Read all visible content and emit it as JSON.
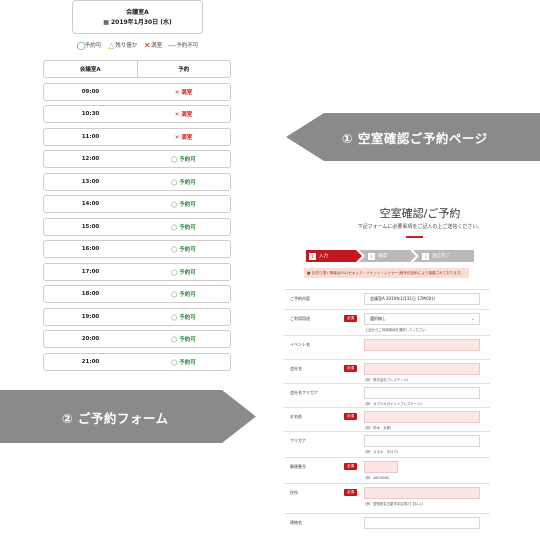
{
  "room_header": {
    "name": "会議室A",
    "date": "▦ 2019年1月30日 (水)"
  },
  "legend": [
    {
      "symbol": "◯",
      "label": "予約可",
      "color": "#2a8a3a"
    },
    {
      "symbol": "△",
      "label": "残り僅か",
      "color": "#e2a12b"
    },
    {
      "symbol": "✕",
      "label": "満室",
      "color": "#d92020"
    },
    {
      "symbol": "―",
      "label": "予約不可",
      "color": "#777777"
    }
  ],
  "grid": {
    "headers": [
      "会議室A",
      "予約"
    ],
    "rows": [
      {
        "time": "09:00",
        "status": "✕ 満室",
        "state": "full"
      },
      {
        "time": "10:30",
        "status": "✕ 満室",
        "state": "full"
      },
      {
        "time": "11:00",
        "status": "✕ 満室",
        "state": "full"
      },
      {
        "time": "12:00",
        "status": "◯ 予約可",
        "state": "ok"
      },
      {
        "time": "13:00",
        "status": "◯ 予約可",
        "state": "ok"
      },
      {
        "time": "14:00",
        "status": "◯ 予約可",
        "state": "ok"
      },
      {
        "time": "15:00",
        "status": "◯ 予約可",
        "state": "ok"
      },
      {
        "time": "16:00",
        "status": "◯ 予約可",
        "state": "ok"
      },
      {
        "time": "17:00",
        "status": "◯ 予約可",
        "state": "ok"
      },
      {
        "time": "18:00",
        "status": "◯ 予約可",
        "state": "ok"
      },
      {
        "time": "19:00",
        "status": "◯ 予約可",
        "state": "ok"
      },
      {
        "time": "20:00",
        "status": "◯ 予約可",
        "state": "ok"
      },
      {
        "time": "21:00",
        "status": "◯ 予約可",
        "state": "ok"
      }
    ]
  },
  "callouts": {
    "availability": "① 空室確認ご予約ページ",
    "form": "② ご予約フォーム"
  },
  "form": {
    "title": "空室確認/ご予約",
    "subtitle": "下記フォームに必要事項をご記入の上ご送信ください。",
    "steps": [
      {
        "num": "1",
        "label": "入力"
      },
      {
        "num": "2",
        "label": "確認"
      },
      {
        "num": "3",
        "label": "送信完了"
      }
    ],
    "notice": "■ お送り頂く情報はSSL(セキュア・ソケット・レイヤー)暗号化技術により保護されております。",
    "required_label": "必須",
    "fields": [
      {
        "label": "ご予約内容",
        "value": "会議室A  2019年1月31日  17時00分",
        "required": false,
        "pink": false
      },
      {
        "label": "ご利用用途",
        "value": "選択無し",
        "required": true,
        "pink": false,
        "hint": "上記からご利用用途を選択してください"
      },
      {
        "label": "イベント名",
        "value": "",
        "required": false,
        "pink": true
      },
      {
        "label": "会社名",
        "value": "",
        "required": true,
        "pink": true,
        "hint": "(例：株式会社ブレステージ)"
      },
      {
        "label": "会社名フリガナ",
        "value": "",
        "required": false,
        "pink": false,
        "hint": "(例：カブシキガイシャブレステージ)"
      },
      {
        "label": "お名前",
        "value": "",
        "required": true,
        "pink": true,
        "hint": "(例：鈴木　太郎)"
      },
      {
        "label": "フリガナ",
        "value": "",
        "required": false,
        "pink": false,
        "hint": "(例：スズキ　タロウ)"
      },
      {
        "label": "郵便番号",
        "value": "",
        "required": true,
        "pink": true,
        "hint": "(例：4600008)"
      },
      {
        "label": "住所",
        "value": "",
        "required": true,
        "pink": true,
        "hint": "(例：愛知県名古屋市中区栄2丁目1-1)"
      },
      {
        "label": "建物名",
        "value": "",
        "required": false,
        "pink": false
      }
    ]
  }
}
